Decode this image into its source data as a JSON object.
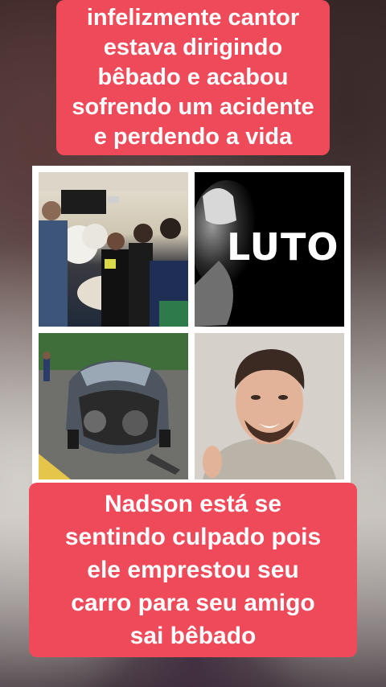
{
  "captions": {
    "top": "infelizmente cantor estava dirigindo bêbado e acabou sofrendo um acidente e perdendo a vida",
    "top_lines": [
      "infelizmente cantor",
      "estava dirigindo",
      "bêbado e acabou",
      "sofrendo um acidente",
      "e perdendo a vida"
    ],
    "bottom_lines": [
      "Nadson está se",
      "sentindo culpado pois",
      "ele emprestou seu",
      "carro para seu amigo",
      "sai bêbado"
    ]
  },
  "collage": {
    "luto_label": "LUTO"
  },
  "colors": {
    "caption_bg": "#ef4a5a",
    "caption_text": "#ffffff",
    "collage_border": "#ffffff"
  }
}
